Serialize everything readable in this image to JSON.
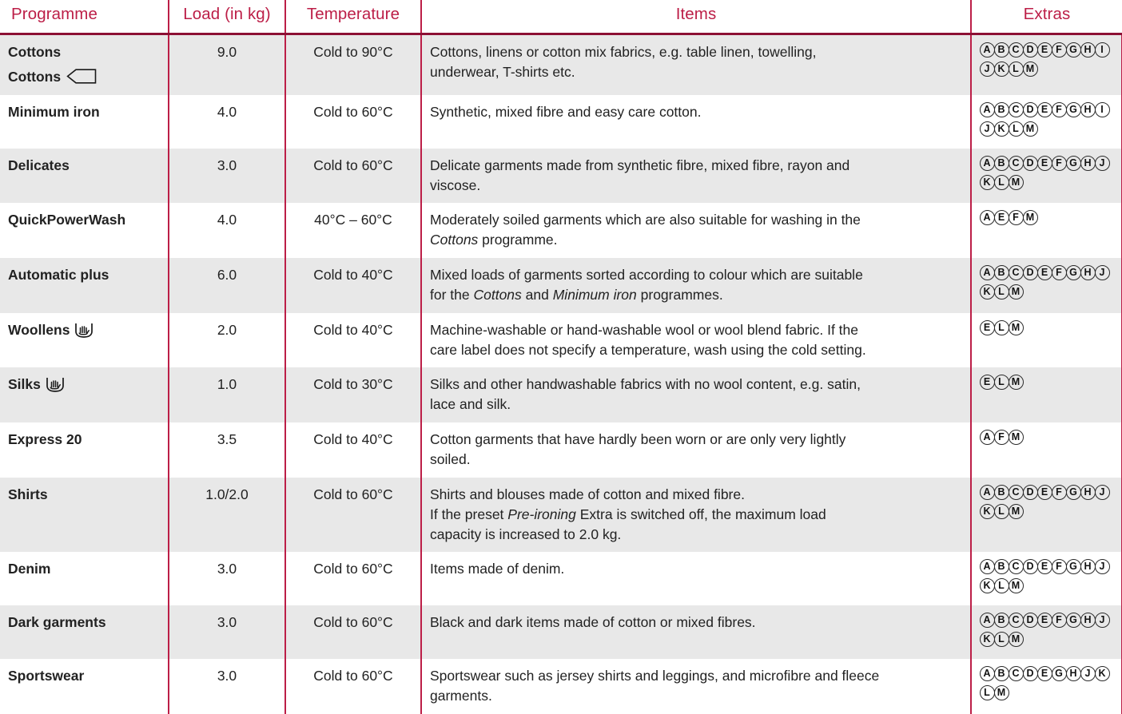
{
  "table": {
    "columns": [
      {
        "key": "programme",
        "label": "Programme"
      },
      {
        "key": "load",
        "label": "Load (in kg)"
      },
      {
        "key": "temperature",
        "label": "Temperature"
      },
      {
        "key": "items",
        "label": "Items"
      },
      {
        "key": "extras",
        "label": "Extras"
      }
    ],
    "accent_color": "#BC1E47",
    "header_rule_color": "#8C1034",
    "row_shade_color": "#e8e8e8",
    "rows": [
      {
        "programme_lines": [
          "Cottons",
          "Cottons"
        ],
        "programme_icon": "eco-arrow-icon",
        "programme_icon_line": 1,
        "load": "9.0",
        "temperature": "Cold to 90°C",
        "item_lines": [
          "Cottons, linens or cotton mix fabrics, e.g. table linen, towelling,",
          "underwear, T-shirts etc."
        ],
        "extras": [
          "A",
          "B",
          "C",
          "D",
          "E",
          "F",
          "G",
          "H",
          "I",
          "J",
          "K",
          "L",
          "M"
        ]
      },
      {
        "programme_lines": [
          "Minimum iron"
        ],
        "load": "4.0",
        "temperature": "Cold to 60°C",
        "item_lines": [
          "Synthetic, mixed fibre and easy care cotton."
        ],
        "extras": [
          "A",
          "B",
          "C",
          "D",
          "E",
          "F",
          "G",
          "H",
          "I",
          "J",
          "K",
          "L",
          "M"
        ]
      },
      {
        "programme_lines": [
          "Delicates"
        ],
        "load": "3.0",
        "temperature": "Cold to 60°C",
        "item_lines": [
          "Delicate garments made from synthetic fibre, mixed fibre, rayon and",
          "viscose."
        ],
        "extras": [
          "A",
          "B",
          "C",
          "D",
          "E",
          "F",
          "G",
          "H",
          "J",
          "K",
          "L",
          "M"
        ]
      },
      {
        "programme_lines": [
          "QuickPowerWash"
        ],
        "load": "4.0",
        "temperature": "40°C – 60°C",
        "item_rich": [
          [
            {
              "t": "Moderately soiled garments which are also suitable for washing in the",
              "i": false
            }
          ],
          [
            {
              "t": "Cottons",
              "i": true
            },
            {
              "t": " programme.",
              "i": false
            }
          ]
        ],
        "extras": [
          "A",
          "E",
          "F",
          "M"
        ]
      },
      {
        "programme_lines": [
          "Automatic plus"
        ],
        "load": "6.0",
        "temperature": "Cold to 40°C",
        "item_rich": [
          [
            {
              "t": "Mixed loads of garments sorted according to colour which are suitable",
              "i": false
            }
          ],
          [
            {
              "t": "for the ",
              "i": false
            },
            {
              "t": "Cottons",
              "i": true
            },
            {
              "t": " and ",
              "i": false
            },
            {
              "t": "Minimum iron",
              "i": true
            },
            {
              "t": " programmes.",
              "i": false
            }
          ]
        ],
        "extras": [
          "A",
          "B",
          "C",
          "D",
          "E",
          "F",
          "G",
          "H",
          "J",
          "K",
          "L",
          "M"
        ]
      },
      {
        "programme_lines": [
          "Woollens"
        ],
        "programme_icon": "hand-wash-icon",
        "programme_icon_line": 0,
        "load": "2.0",
        "temperature": "Cold to 40°C",
        "item_lines": [
          "Machine-washable or hand-washable wool or wool blend fabric. If the",
          "care label does not specify a temperature, wash using the cold setting."
        ],
        "extras": [
          "E",
          "L",
          "M"
        ]
      },
      {
        "programme_lines": [
          "Silks"
        ],
        "programme_icon": "hand-wash-icon",
        "programme_icon_line": 0,
        "load": "1.0",
        "temperature": "Cold to 30°C",
        "item_lines": [
          "Silks and other handwashable fabrics with no wool content, e.g. satin,",
          "lace and silk."
        ],
        "extras": [
          "E",
          "L",
          "M"
        ]
      },
      {
        "programme_lines": [
          "Express 20"
        ],
        "load": "3.5",
        "temperature": "Cold to 40°C",
        "item_lines": [
          "Cotton garments that have hardly been worn or are only very lightly",
          "soiled."
        ],
        "extras": [
          "A",
          "F",
          "M"
        ]
      },
      {
        "programme_lines": [
          "Shirts"
        ],
        "load": "1.0/2.0",
        "temperature": "Cold to 60°C",
        "item_rich": [
          [
            {
              "t": "Shirts and blouses made of cotton and mixed fibre.",
              "i": false
            }
          ],
          [
            {
              "t": "If the preset ",
              "i": false
            },
            {
              "t": "Pre-ironing",
              "i": true
            },
            {
              "t": " Extra is switched off, the maximum load",
              "i": false
            }
          ],
          [
            {
              "t": "capacity is increased to 2.0 kg.",
              "i": false
            }
          ]
        ],
        "extras": [
          "A",
          "B",
          "C",
          "D",
          "E",
          "F",
          "G",
          "H",
          "J",
          "K",
          "L",
          "M"
        ]
      },
      {
        "programme_lines": [
          "Denim"
        ],
        "load": "3.0",
        "temperature": "Cold to 60°C",
        "item_lines": [
          "Items made of denim."
        ],
        "extras": [
          "A",
          "B",
          "C",
          "D",
          "E",
          "F",
          "G",
          "H",
          "J",
          "K",
          "L",
          "M"
        ]
      },
      {
        "programme_lines": [
          "Dark garments"
        ],
        "load": "3.0",
        "temperature": "Cold to 60°C",
        "item_lines": [
          "Black and dark items made of cotton or mixed fibres."
        ],
        "extras": [
          "A",
          "B",
          "C",
          "D",
          "E",
          "F",
          "G",
          "H",
          "J",
          "K",
          "L",
          "M"
        ]
      },
      {
        "programme_lines": [
          "Sportswear"
        ],
        "load": "3.0",
        "temperature": "Cold to 60°C",
        "item_lines": [
          "Sportswear such as jersey shirts and leggings, and microfibre and fleece",
          "garments."
        ],
        "extras": [
          "A",
          "B",
          "C",
          "D",
          "E",
          "G",
          "H",
          "J",
          "K",
          "L",
          "M"
        ]
      }
    ]
  }
}
